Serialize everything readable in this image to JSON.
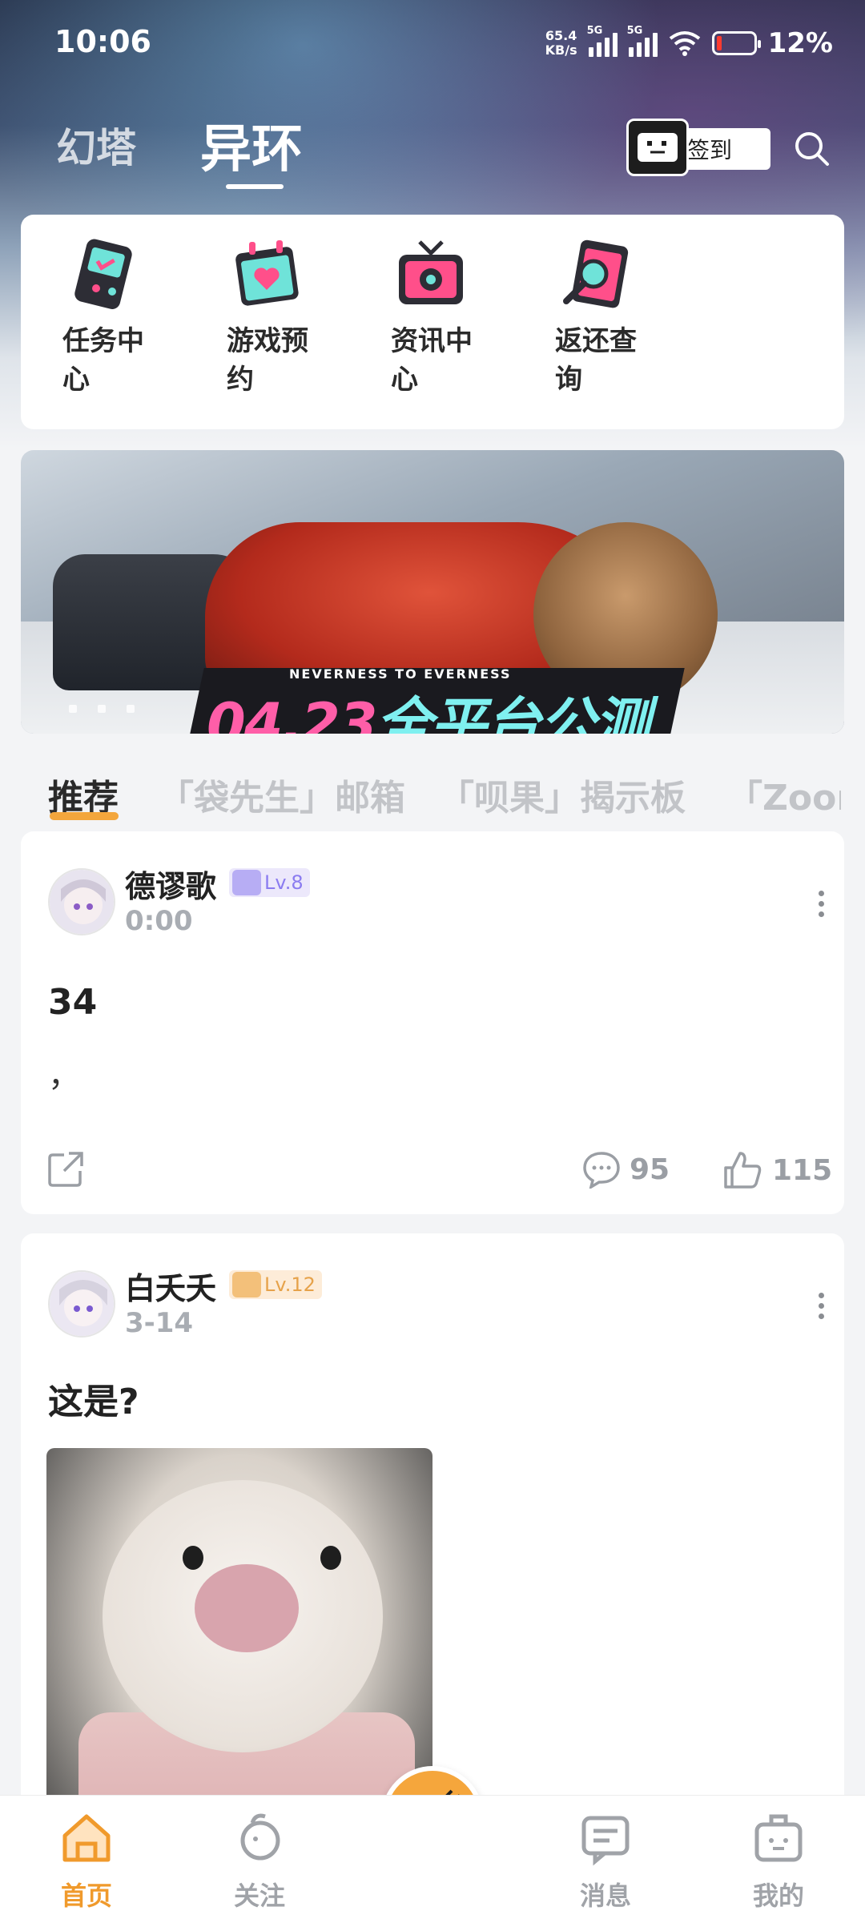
{
  "status_bar": {
    "time": "10:06",
    "speed_value": "65.4",
    "speed_unit": "KB/s",
    "net1": "5G",
    "net2": "5G",
    "battery": "12%"
  },
  "header": {
    "tabs": [
      "幻塔",
      "异环"
    ],
    "active_tab": "异环",
    "signin_label": "签到"
  },
  "shortcuts": [
    {
      "label": "任务中心",
      "icon": "gamepad-icon"
    },
    {
      "label": "游戏预约",
      "icon": "calendar-heart-icon"
    },
    {
      "label": "资讯中心",
      "icon": "tv-icon"
    },
    {
      "label": "返还查询",
      "icon": "clipboard-search-icon"
    }
  ],
  "banner": {
    "subtitle": "NEVERNESS TO EVERNESS",
    "title_date": "04.23",
    "title_text": "全平台公测"
  },
  "category_tabs": [
    "推荐",
    "「袋先生」邮箱",
    "「呗果」揭示板",
    "「Zoor"
  ],
  "posts": [
    {
      "username": "德谬歌",
      "level": "Lv.8",
      "time": "0:00",
      "title": "34",
      "body": "，",
      "comments": "95",
      "likes": "115"
    },
    {
      "username": "白夭夭",
      "level": "Lv.12",
      "time": "3-14",
      "title": "这是?"
    }
  ],
  "bottom_nav": [
    {
      "label": "首页",
      "icon": "home-icon",
      "active": true
    },
    {
      "label": "关注",
      "icon": "follow-icon",
      "active": false
    },
    {
      "label": "",
      "icon": "mascot-icon",
      "active": false
    },
    {
      "label": "消息",
      "icon": "message-icon",
      "active": false
    },
    {
      "label": "我的",
      "icon": "profile-icon",
      "active": false
    }
  ],
  "colors": {
    "accent": "#f09a2c",
    "level_purple": "#8b7cf0",
    "level_orange": "#e6a24a"
  }
}
